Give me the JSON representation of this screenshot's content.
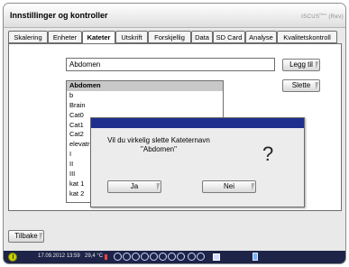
{
  "window": {
    "title": "Innstillinger og kontroller",
    "brand": "ISCUS",
    "brand_super": "flex",
    "brand_suffix": "(Rev)"
  },
  "tabs": [
    {
      "label": "Skalering",
      "active": false
    },
    {
      "label": "Enheter",
      "active": false
    },
    {
      "label": "Kateter",
      "active": true
    },
    {
      "label": "Utskrift",
      "active": false
    },
    {
      "label": "Forskjellig",
      "active": false
    },
    {
      "label": "Data",
      "active": false
    },
    {
      "label": "SD Card",
      "active": false
    },
    {
      "label": "Analyse",
      "active": false
    },
    {
      "label": "Kvalitetskontroll",
      "active": false
    }
  ],
  "catheter": {
    "name_value": "Abdomen",
    "add_label": "Legg til",
    "delete_label": "Slette",
    "list": [
      "Abdomen",
      "b",
      "Brain",
      "Cat0",
      "Cat1",
      "Cat2",
      "elevatr",
      "I",
      "II",
      "III",
      "kat 1",
      "kat 2"
    ],
    "selected": "Abdomen"
  },
  "dialog": {
    "message_line1": "Vil du virkelig slette Kateternavn",
    "message_line2": "\"Abdomen\"",
    "icon": "?",
    "yes_label": "Ja",
    "no_label": "Nei"
  },
  "footer": {
    "back_label": "Tilbake"
  },
  "status": {
    "datetime": "17.09.2012 13:59",
    "temperature": "29,4 °C"
  },
  "colors": {
    "dialog_titlebar": "#1f2f8e",
    "statusbar": "#1d2448",
    "selection": "#c8c8c8"
  }
}
